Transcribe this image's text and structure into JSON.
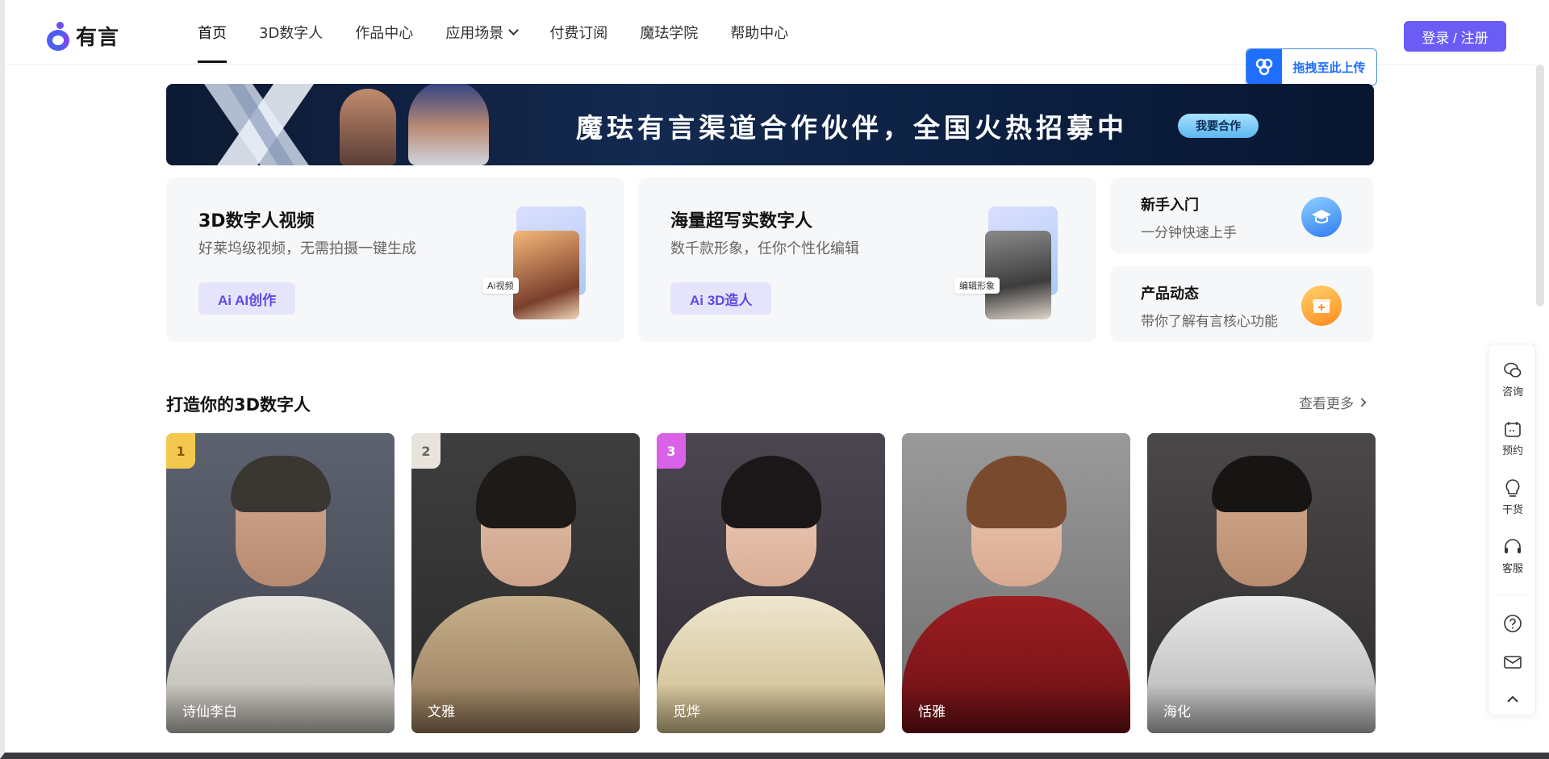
{
  "brand": {
    "logo_text": "有言",
    "accent": "#6b5cf6"
  },
  "nav": {
    "items": [
      {
        "label": "首页",
        "active": true
      },
      {
        "label": "3D数字人"
      },
      {
        "label": "作品中心"
      },
      {
        "label": "应用场景",
        "has_dropdown": true
      },
      {
        "label": "付费订阅"
      },
      {
        "label": "魔珐学院"
      },
      {
        "label": "帮助中心"
      }
    ],
    "login_label": "登录 / 注册"
  },
  "upload_float": {
    "label": "拖拽至此上传",
    "icon": "cloud-share-icon"
  },
  "banner": {
    "title": "魔珐有言渠道合作伙伴，全国火热招募中",
    "button": "我要合作"
  },
  "features": {
    "video": {
      "title": "3D数字人视频",
      "subtitle": "好莱坞级视频，无需拍摄一键生成",
      "button": "Ai AI创作",
      "tag": "Ai视频"
    },
    "avatar": {
      "title": "海量超写实数字人",
      "subtitle": "数千款形象，任你个性化编辑",
      "button": "Ai 3D造人",
      "tag": "编辑形象"
    },
    "beginner": {
      "title": "新手入门",
      "subtitle": "一分钟快速上手",
      "icon": "graduation-cap-icon"
    },
    "news": {
      "title": "产品动态",
      "subtitle": "带你了解有言核心功能",
      "icon": "gift-box-icon"
    }
  },
  "section": {
    "title": "打造你的3D数字人",
    "see_more": "查看更多",
    "avatars": [
      {
        "name": "诗仙李白",
        "rank": "1"
      },
      {
        "name": "文雅",
        "rank": "2"
      },
      {
        "name": "觅烨",
        "rank": "3"
      },
      {
        "name": "恬雅"
      },
      {
        "name": "海化"
      }
    ]
  },
  "side_tools": [
    {
      "label": "咨询",
      "icon": "wechat-icon"
    },
    {
      "label": "预约",
      "icon": "calendar-icon"
    },
    {
      "label": "干货",
      "icon": "ai-bulb-icon"
    },
    {
      "label": "客服",
      "icon": "headset-icon"
    },
    {
      "label": "",
      "icon": "help-circle-icon"
    },
    {
      "label": "",
      "icon": "mail-icon"
    },
    {
      "label": "",
      "icon": "chevron-up-icon"
    }
  ]
}
